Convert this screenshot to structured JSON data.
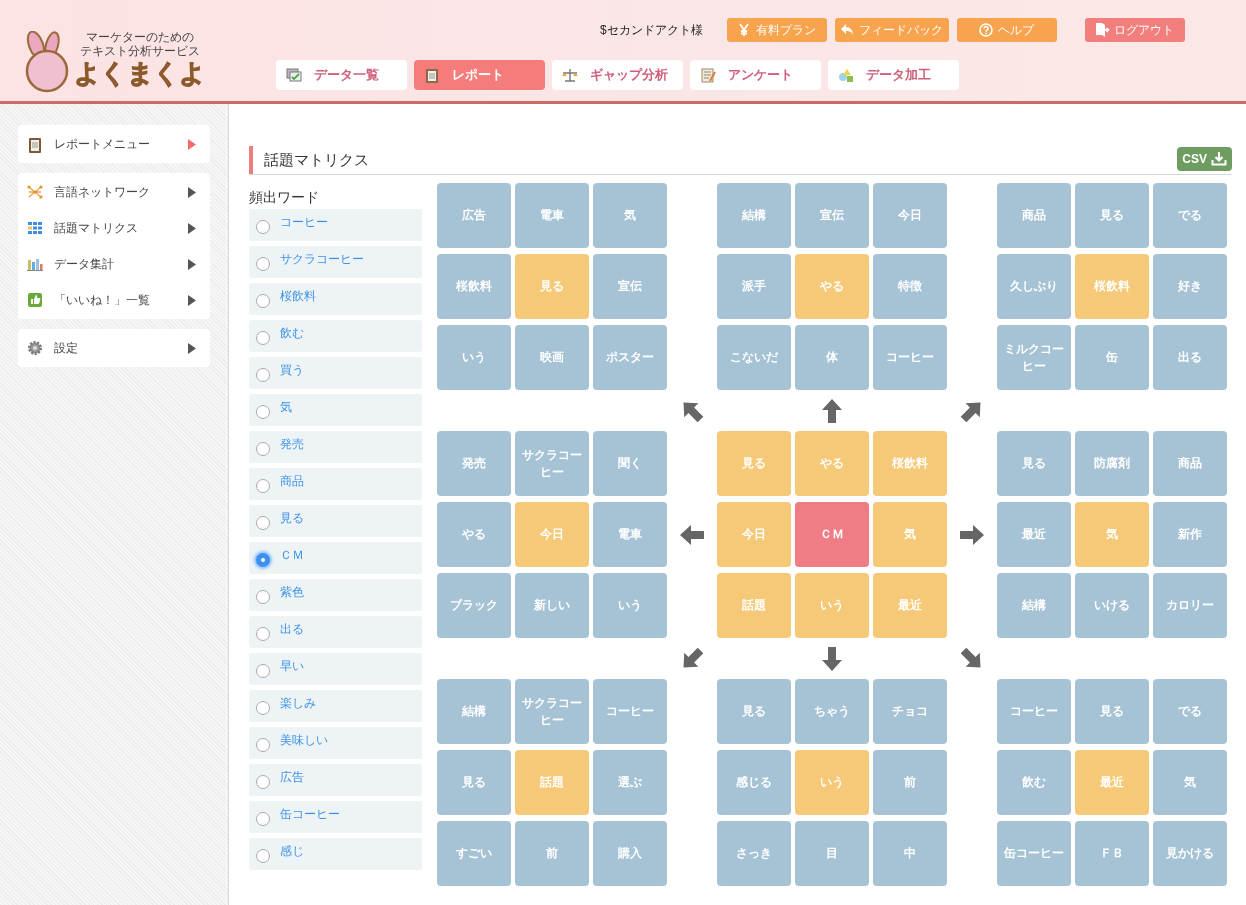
{
  "logo": {
    "tagline": [
      "マーケターのための",
      "テキスト分析サービス"
    ],
    "name": "よくまくよ"
  },
  "user": "$セカンドアクト様",
  "top_buttons": [
    {
      "label": "有料プラン",
      "kind": "yen"
    },
    {
      "label": "フィードバック",
      "kind": "feedback"
    },
    {
      "label": "ヘルプ",
      "kind": "help"
    },
    {
      "label": "ログアウト",
      "kind": "logout"
    }
  ],
  "nav_tabs": [
    {
      "label": "データ一覧",
      "kind": "list",
      "selected": false
    },
    {
      "label": "レポート",
      "kind": "report",
      "selected": true
    },
    {
      "label": "ギャップ分析",
      "kind": "scale",
      "selected": false
    },
    {
      "label": "アンケート",
      "kind": "survey",
      "selected": false
    },
    {
      "label": "データ加工",
      "kind": "shapes",
      "selected": false
    }
  ],
  "sidebar": {
    "groups": [
      {
        "items": [
          {
            "label": "レポートメニュー",
            "kind": "heading"
          }
        ]
      },
      {
        "items": [
          {
            "label": "言語ネットワーク",
            "kind": "link"
          },
          {
            "label": "話題マトリクス",
            "kind": "link"
          },
          {
            "label": "データ集計",
            "kind": "link"
          },
          {
            "label": "「いいね！」一覧",
            "kind": "link"
          }
        ]
      },
      {
        "items": [
          {
            "label": "設定",
            "kind": "link"
          }
        ]
      }
    ]
  },
  "section": {
    "title": "話題マトリクス",
    "csv_button": "CSV"
  },
  "words": {
    "heading": "頻出ワード",
    "items": [
      {
        "label": "コーヒー",
        "selected": false
      },
      {
        "label": "サクラコーヒー",
        "selected": false
      },
      {
        "label": "桜飲料",
        "selected": false
      },
      {
        "label": "飲む",
        "selected": false
      },
      {
        "label": "買う",
        "selected": false
      },
      {
        "label": "気",
        "selected": false
      },
      {
        "label": "発売",
        "selected": false
      },
      {
        "label": "商品",
        "selected": false
      },
      {
        "label": "見る",
        "selected": false
      },
      {
        "label": "ＣＭ",
        "selected": true
      },
      {
        "label": "紫色",
        "selected": false
      },
      {
        "label": "出る",
        "selected": false
      },
      {
        "label": "早い",
        "selected": false
      },
      {
        "label": "楽しみ",
        "selected": false
      },
      {
        "label": "美味しい",
        "selected": false
      },
      {
        "label": "広告",
        "selected": false
      },
      {
        "label": "缶コーヒー",
        "selected": false
      },
      {
        "label": "感じ",
        "selected": false
      }
    ]
  },
  "matrix": {
    "blocks": [
      {
        "cells": [
          {
            "text": "広告",
            "kind": "plain"
          },
          {
            "text": "電車",
            "kind": "plain"
          },
          {
            "text": "気",
            "kind": "plain"
          },
          {
            "text": "桜飲料",
            "kind": "plain"
          },
          {
            "text": "見る",
            "kind": "accent"
          },
          {
            "text": "宣伝",
            "kind": "plain"
          },
          {
            "text": "いう",
            "kind": "plain"
          },
          {
            "text": "映画",
            "kind": "plain"
          },
          {
            "text": "ポスター",
            "kind": "plain"
          }
        ]
      },
      {
        "cells": [
          {
            "text": "結構",
            "kind": "plain"
          },
          {
            "text": "宣伝",
            "kind": "plain"
          },
          {
            "text": "今日",
            "kind": "plain"
          },
          {
            "text": "派手",
            "kind": "plain"
          },
          {
            "text": "やる",
            "kind": "accent"
          },
          {
            "text": "特徴",
            "kind": "plain"
          },
          {
            "text": "こないだ",
            "kind": "plain"
          },
          {
            "text": "体",
            "kind": "plain"
          },
          {
            "text": "コーヒー",
            "kind": "plain"
          }
        ]
      },
      {
        "cells": [
          {
            "text": "商品",
            "kind": "plain"
          },
          {
            "text": "見る",
            "kind": "plain"
          },
          {
            "text": "でる",
            "kind": "plain"
          },
          {
            "text": "久しぶり",
            "kind": "plain"
          },
          {
            "text": "桜飲料",
            "kind": "accent"
          },
          {
            "text": "好き",
            "kind": "plain"
          },
          {
            "text": "ミルクコーヒー",
            "kind": "plain"
          },
          {
            "text": "缶",
            "kind": "plain"
          },
          {
            "text": "出る",
            "kind": "plain"
          }
        ]
      },
      {
        "cells": [
          {
            "text": "発売",
            "kind": "plain"
          },
          {
            "text": "サクラコーヒー",
            "kind": "plain"
          },
          {
            "text": "聞く",
            "kind": "plain"
          },
          {
            "text": "やる",
            "kind": "plain"
          },
          {
            "text": "今日",
            "kind": "accent"
          },
          {
            "text": "電車",
            "kind": "plain"
          },
          {
            "text": "ブラック",
            "kind": "plain"
          },
          {
            "text": "新しい",
            "kind": "plain"
          },
          {
            "text": "いう",
            "kind": "plain"
          }
        ]
      },
      {
        "cells": [
          {
            "text": "見る",
            "kind": "accent"
          },
          {
            "text": "やる",
            "kind": "accent"
          },
          {
            "text": "桜飲料",
            "kind": "accent"
          },
          {
            "text": "今日",
            "kind": "accent"
          },
          {
            "text": "ＣＭ",
            "kind": "focus"
          },
          {
            "text": "気",
            "kind": "accent"
          },
          {
            "text": "話題",
            "kind": "accent"
          },
          {
            "text": "いう",
            "kind": "accent"
          },
          {
            "text": "最近",
            "kind": "accent"
          }
        ]
      },
      {
        "cells": [
          {
            "text": "見る",
            "kind": "plain"
          },
          {
            "text": "防腐剤",
            "kind": "plain"
          },
          {
            "text": "商品",
            "kind": "plain"
          },
          {
            "text": "最近",
            "kind": "plain"
          },
          {
            "text": "気",
            "kind": "accent"
          },
          {
            "text": "新作",
            "kind": "plain"
          },
          {
            "text": "結構",
            "kind": "plain"
          },
          {
            "text": "いける",
            "kind": "plain"
          },
          {
            "text": "カロリー",
            "kind": "plain"
          }
        ]
      },
      {
        "cells": [
          {
            "text": "結構",
            "kind": "plain"
          },
          {
            "text": "サクラコーヒー",
            "kind": "plain"
          },
          {
            "text": "コーヒー",
            "kind": "plain"
          },
          {
            "text": "見る",
            "kind": "plain"
          },
          {
            "text": "話題",
            "kind": "accent"
          },
          {
            "text": "選ぶ",
            "kind": "plain"
          },
          {
            "text": "すごい",
            "kind": "plain"
          },
          {
            "text": "前",
            "kind": "plain"
          },
          {
            "text": "購入",
            "kind": "plain"
          }
        ]
      },
      {
        "cells": [
          {
            "text": "見る",
            "kind": "plain"
          },
          {
            "text": "ちゃう",
            "kind": "plain"
          },
          {
            "text": "チョコ",
            "kind": "plain"
          },
          {
            "text": "感じる",
            "kind": "plain"
          },
          {
            "text": "いう",
            "kind": "accent"
          },
          {
            "text": "前",
            "kind": "plain"
          },
          {
            "text": "さっき",
            "kind": "plain"
          },
          {
            "text": "目",
            "kind": "plain"
          },
          {
            "text": "中",
            "kind": "plain"
          }
        ]
      },
      {
        "cells": [
          {
            "text": "コーヒー",
            "kind": "plain"
          },
          {
            "text": "見る",
            "kind": "plain"
          },
          {
            "text": "でる",
            "kind": "plain"
          },
          {
            "text": "飲む",
            "kind": "plain"
          },
          {
            "text": "最近",
            "kind": "accent"
          },
          {
            "text": "気",
            "kind": "plain"
          },
          {
            "text": "缶コーヒー",
            "kind": "plain"
          },
          {
            "text": "ＦＢ",
            "kind": "plain"
          },
          {
            "text": "見かける",
            "kind": "plain"
          }
        ]
      }
    ]
  }
}
